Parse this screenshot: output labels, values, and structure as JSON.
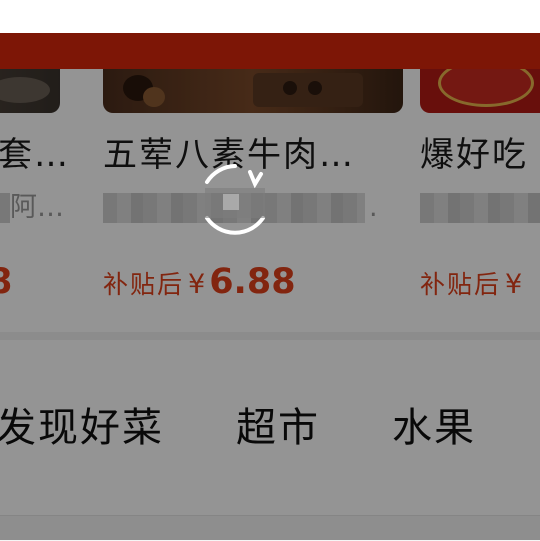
{
  "products": [
    {
      "title": "套…",
      "subtitle": "阿…",
      "price_prefix": "",
      "currency": "",
      "price": "8"
    },
    {
      "title": "五荤八素牛肉…",
      "subtitle": ".",
      "price_prefix": "补贴后",
      "currency": "¥",
      "price": "6.88"
    },
    {
      "title": "爆好吃",
      "subtitle": "",
      "price_prefix": "补贴后",
      "currency": "¥",
      "price": ""
    }
  ],
  "categories": [
    "发现好菜",
    "超市",
    "水果"
  ],
  "colors": {
    "accent_red": "#d8270c",
    "price_red": "#e0401a",
    "overlay": "rgba(0,0,0,0.42)"
  },
  "loading": {
    "icon": "loading-spinner-icon"
  }
}
